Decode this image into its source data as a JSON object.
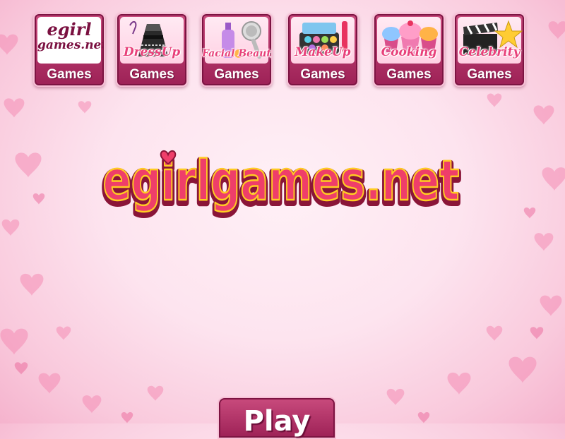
{
  "nav": {
    "brand": {
      "line1": "egirl",
      "line2": "games.net",
      "label": "Games"
    },
    "tiles": [
      {
        "script": "DressUp",
        "label": "Games",
        "icon": "dress-icon"
      },
      {
        "script": "Facial Beauty",
        "label": "Games",
        "icon": "lotion-shower-icon"
      },
      {
        "script": "MakeUp",
        "label": "Games",
        "icon": "makeup-palette-icon"
      },
      {
        "script": "Cooking",
        "label": "Games",
        "icon": "cupcakes-icon"
      },
      {
        "script": "Celebrity",
        "label": "Games",
        "icon": "clapperboard-star-icon"
      }
    ]
  },
  "logo": {
    "text": "egirlgames.net"
  },
  "play": {
    "label": "Play"
  },
  "colors": {
    "tile": "#b4336a",
    "accent": "#e8407a",
    "logo_red": "#e8325f",
    "logo_yellow": "#ffcc22"
  }
}
